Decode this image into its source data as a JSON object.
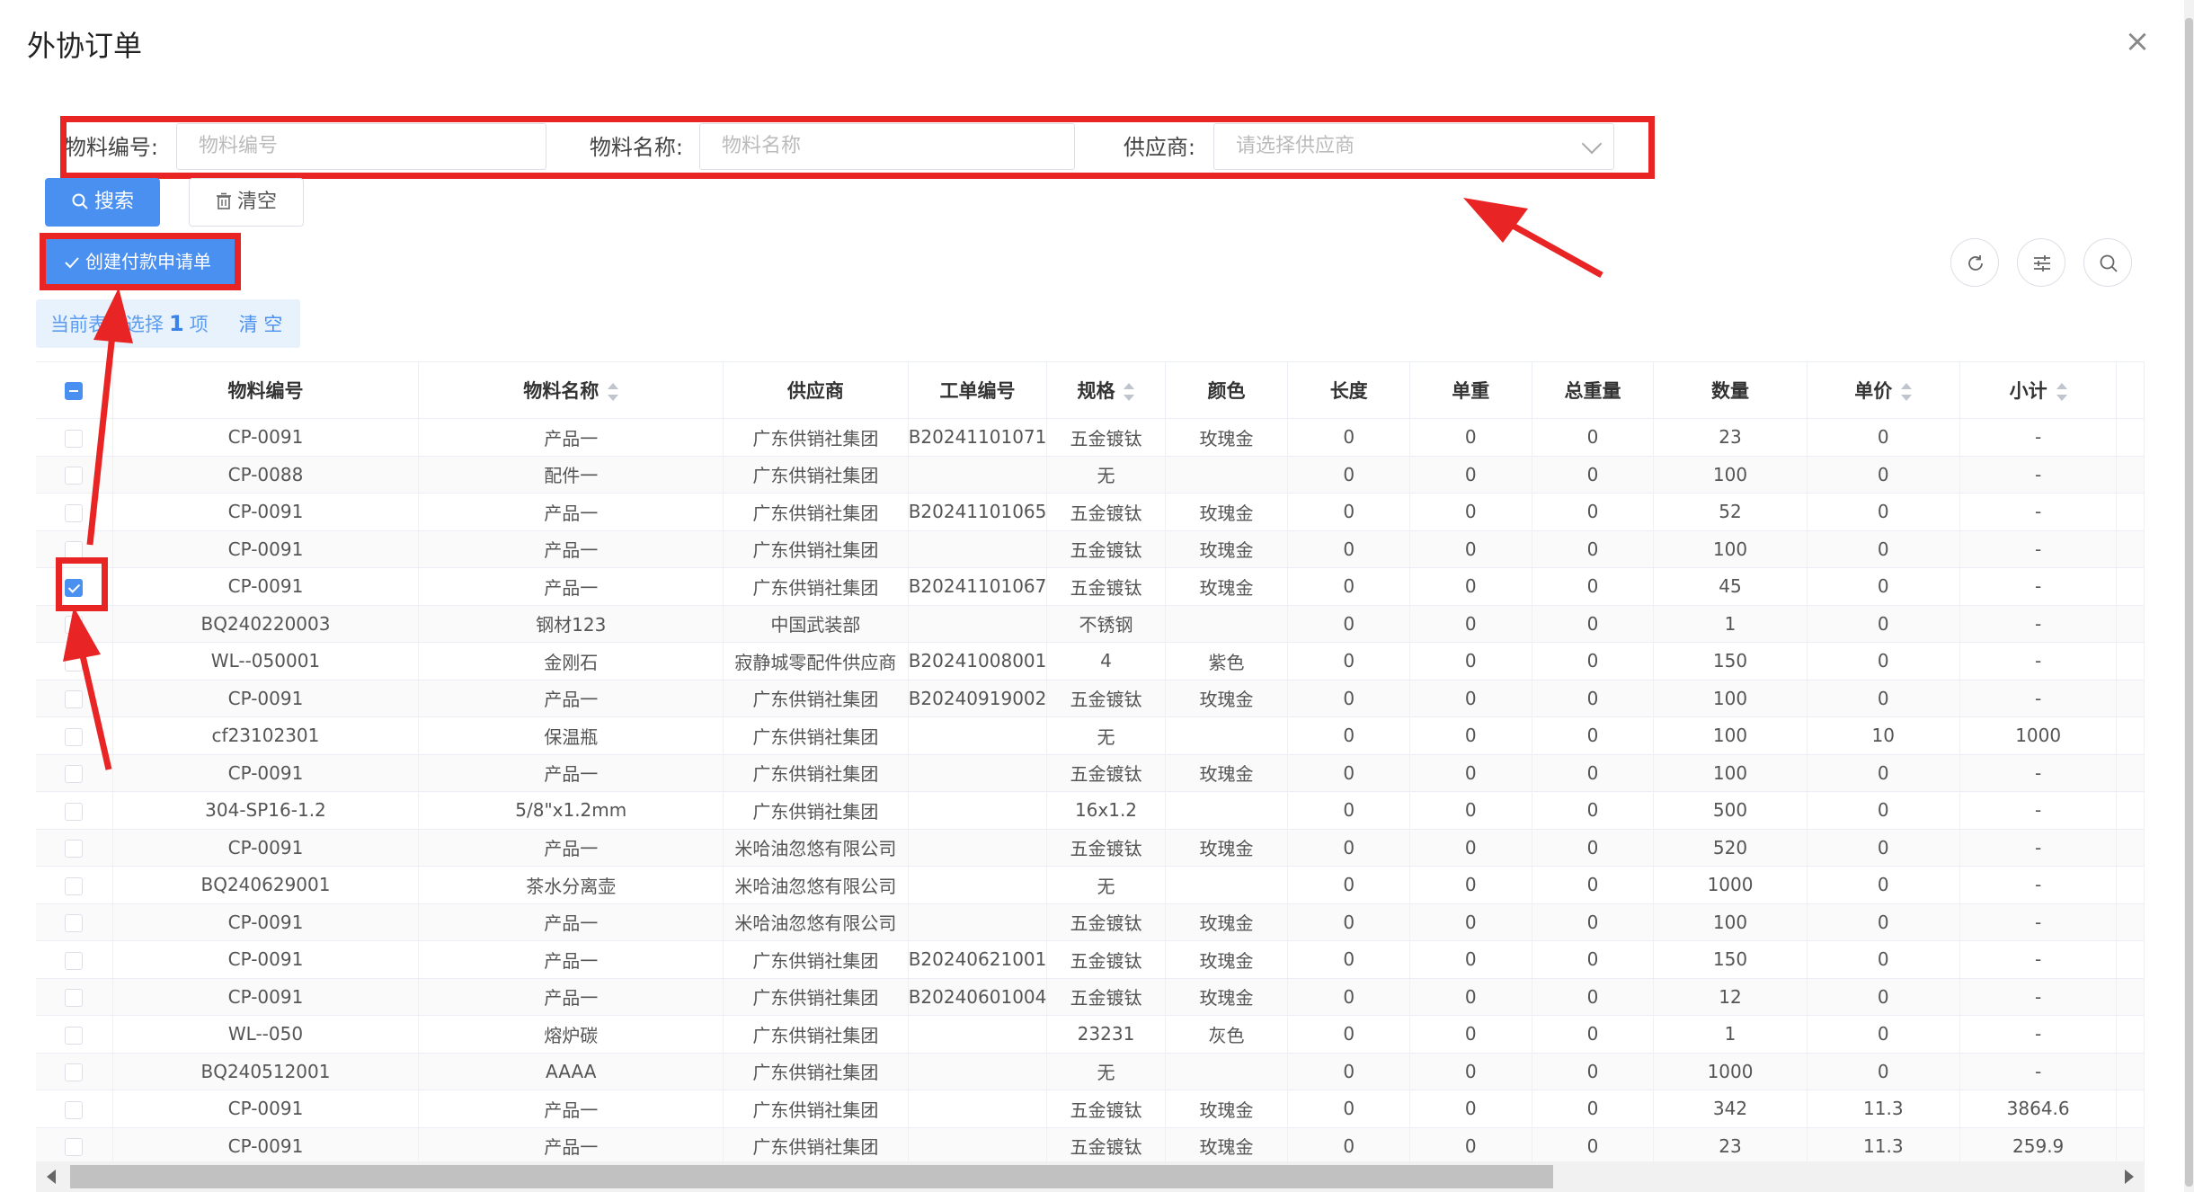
{
  "dialog": {
    "title": "外协订单",
    "close_icon": "close-icon"
  },
  "search_form": {
    "material_code_label": "物料编号:",
    "material_code_placeholder": "物料编号",
    "material_name_label": "物料名称:",
    "material_name_placeholder": "物料名称",
    "supplier_label": "供应商:",
    "supplier_placeholder": "请选择供应商",
    "search_button": "搜索",
    "clear_button": "清空"
  },
  "toolbar": {
    "create_payment_button": "创建付款申请单",
    "refresh_icon": "refresh-icon",
    "column_settings_icon": "sliders-icon",
    "search_toggle_icon": "search-icon"
  },
  "selection_alert": {
    "prefix": "当前表",
    "middle": "已选择",
    "count": "1",
    "suffix": "项",
    "clear_link": "清 空"
  },
  "table": {
    "columns": [
      "物料编号",
      "物料名称",
      "供应商",
      "工单编号",
      "规格",
      "颜色",
      "长度",
      "单重",
      "总重量",
      "数量",
      "单价",
      "小计"
    ],
    "rows": [
      {
        "checked": false,
        "cells": [
          "CP-0091",
          "产品一",
          "广东供销社集团",
          "B20241101071",
          "五金镀钛",
          "玫瑰金",
          "0",
          "0",
          "0",
          "23",
          "0",
          "-"
        ]
      },
      {
        "checked": false,
        "cells": [
          "CP-0088",
          "配件一",
          "广东供销社集团",
          "",
          "无",
          "",
          "0",
          "0",
          "0",
          "100",
          "0",
          "-"
        ]
      },
      {
        "checked": false,
        "cells": [
          "CP-0091",
          "产品一",
          "广东供销社集团",
          "B20241101065",
          "五金镀钛",
          "玫瑰金",
          "0",
          "0",
          "0",
          "52",
          "0",
          "-"
        ]
      },
      {
        "checked": false,
        "cells": [
          "CP-0091",
          "产品一",
          "广东供销社集团",
          "",
          "五金镀钛",
          "玫瑰金",
          "0",
          "0",
          "0",
          "100",
          "0",
          "-"
        ]
      },
      {
        "checked": true,
        "cells": [
          "CP-0091",
          "产品一",
          "广东供销社集团",
          "B20241101067",
          "五金镀钛",
          "玫瑰金",
          "0",
          "0",
          "0",
          "45",
          "0",
          "-"
        ]
      },
      {
        "checked": false,
        "cells": [
          "BQ240220003",
          "钢材123",
          "中国武装部",
          "",
          "不锈钢",
          "",
          "0",
          "0",
          "0",
          "1",
          "0",
          "-"
        ]
      },
      {
        "checked": false,
        "cells": [
          "WL--050001",
          "金刚石",
          "寂静城零配件供应商",
          "B20241008001",
          "4",
          "紫色",
          "0",
          "0",
          "0",
          "150",
          "0",
          "-"
        ]
      },
      {
        "checked": false,
        "cells": [
          "CP-0091",
          "产品一",
          "广东供销社集团",
          "B20240919002",
          "五金镀钛",
          "玫瑰金",
          "0",
          "0",
          "0",
          "100",
          "0",
          "-"
        ]
      },
      {
        "checked": false,
        "cells": [
          "cf23102301",
          "保温瓶",
          "广东供销社集团",
          "",
          "无",
          "",
          "0",
          "0",
          "0",
          "100",
          "10",
          "1000"
        ]
      },
      {
        "checked": false,
        "cells": [
          "CP-0091",
          "产品一",
          "广东供销社集团",
          "",
          "五金镀钛",
          "玫瑰金",
          "0",
          "0",
          "0",
          "100",
          "0",
          "-"
        ]
      },
      {
        "checked": false,
        "cells": [
          "304-SP16-1.2",
          "5/8\"x1.2mm",
          "广东供销社集团",
          "",
          "16x1.2",
          "",
          "0",
          "0",
          "0",
          "500",
          "0",
          "-"
        ]
      },
      {
        "checked": false,
        "cells": [
          "CP-0091",
          "产品一",
          "米哈油忽悠有限公司",
          "",
          "五金镀钛",
          "玫瑰金",
          "0",
          "0",
          "0",
          "520",
          "0",
          "-"
        ]
      },
      {
        "checked": false,
        "cells": [
          "BQ240629001",
          "茶水分离壶",
          "米哈油忽悠有限公司",
          "",
          "无",
          "",
          "0",
          "0",
          "0",
          "1000",
          "0",
          "-"
        ]
      },
      {
        "checked": false,
        "cells": [
          "CP-0091",
          "产品一",
          "米哈油忽悠有限公司",
          "",
          "五金镀钛",
          "玫瑰金",
          "0",
          "0",
          "0",
          "100",
          "0",
          "-"
        ]
      },
      {
        "checked": false,
        "cells": [
          "CP-0091",
          "产品一",
          "广东供销社集团",
          "B20240621001",
          "五金镀钛",
          "玫瑰金",
          "0",
          "0",
          "0",
          "150",
          "0",
          "-"
        ]
      },
      {
        "checked": false,
        "cells": [
          "CP-0091",
          "产品一",
          "广东供销社集团",
          "B20240601004",
          "五金镀钛",
          "玫瑰金",
          "0",
          "0",
          "0",
          "12",
          "0",
          "-"
        ]
      },
      {
        "checked": false,
        "cells": [
          "WL--050",
          "熔炉碳",
          "广东供销社集团",
          "",
          "23231",
          "灰色",
          "0",
          "0",
          "0",
          "1",
          "0",
          "-"
        ]
      },
      {
        "checked": false,
        "cells": [
          "BQ240512001",
          "AAAA",
          "广东供销社集团",
          "",
          "无",
          "",
          "0",
          "0",
          "0",
          "1000",
          "0",
          "-"
        ]
      },
      {
        "checked": false,
        "cells": [
          "CP-0091",
          "产品一",
          "广东供销社集团",
          "",
          "五金镀钛",
          "玫瑰金",
          "0",
          "0",
          "0",
          "342",
          "11.3",
          "3864.6"
        ]
      },
      {
        "checked": false,
        "cells": [
          "CP-0091",
          "产品一",
          "广东供销社集团",
          "",
          "五金镀钛",
          "玫瑰金",
          "0",
          "0",
          "0",
          "23",
          "11.3",
          "259.9"
        ]
      }
    ]
  },
  "colors": {
    "primary": "#4a90f0",
    "annotation_red": "#e82424"
  }
}
